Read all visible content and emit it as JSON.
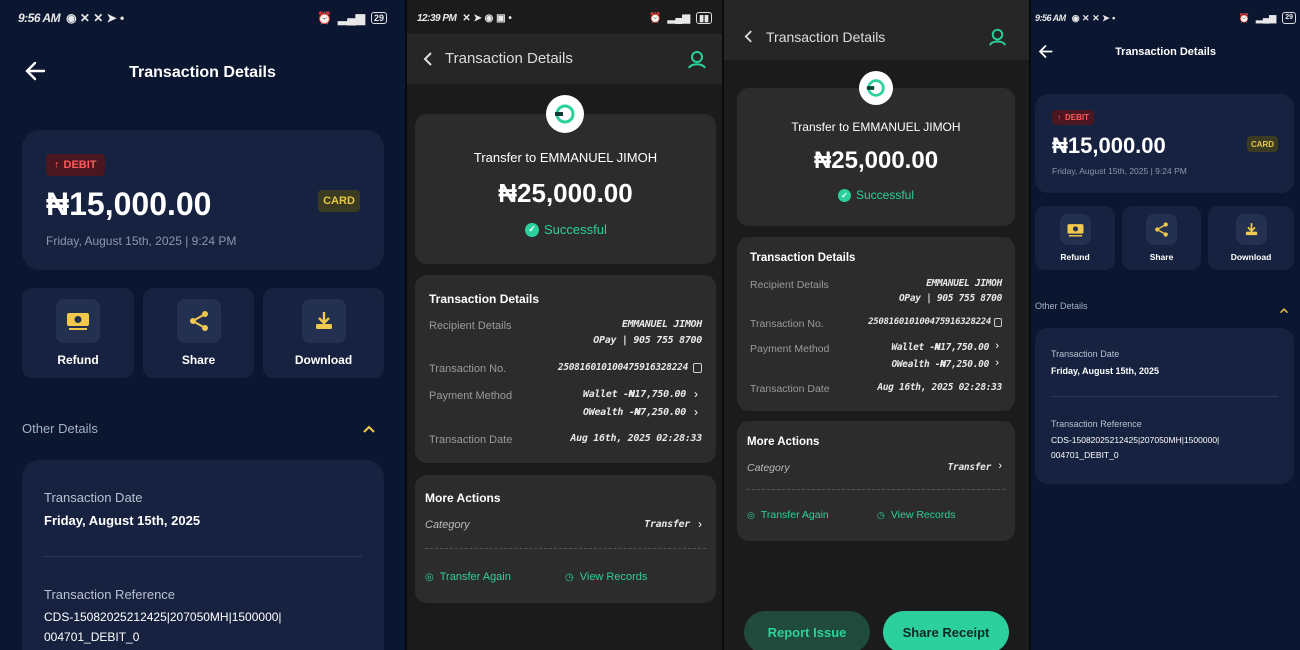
{
  "screen1": {
    "status": {
      "time": "9:56 AM",
      "battery": "29"
    },
    "title": "Transaction Details",
    "debit_label": "DEBIT",
    "amount": "₦15,000.00",
    "card_label": "CARD",
    "datetime": "Friday, August 15th, 2025 | 9:24 PM",
    "actions": [
      "Refund",
      "Share",
      "Download"
    ],
    "other_details": "Other Details",
    "date_label": "Transaction Date",
    "date_value": "Friday, August 15th, 2025",
    "ref_label": "Transaction Reference",
    "ref_line1": "CDS-15082025212425|207050MH|1500000|",
    "ref_line2": "004701_DEBIT_0"
  },
  "screen2": {
    "status": {
      "time": "12:39 PM"
    },
    "title": "Transaction Details",
    "transfer_to": "Transfer to EMMANUEL JIMOH",
    "amount": "₦25,000.00",
    "status_text": "Successful",
    "section": "Transaction Details",
    "recipient_label": "Recipient Details",
    "recipient_name": "EMMANUEL JIMOH",
    "recipient_bank": "OPay | 905 755 8700",
    "txn_no_label": "Transaction No.",
    "txn_no": "250816010100475916328224",
    "payment_label": "Payment Method",
    "pay1": "Wallet -₦17,750.00",
    "pay2": "OWealth -₦7,250.00",
    "date_label": "Transaction Date",
    "date_value": "Aug 16th, 2025 02:28:33",
    "more_actions": "More Actions",
    "category_label": "Category",
    "category_value": "Transfer",
    "transfer_again": "Transfer Again",
    "view_records": "View Records"
  },
  "screen3": {
    "title": "Transaction Details",
    "transfer_to": "Transfer to EMMANUEL JIMOH",
    "amount": "₦25,000.00",
    "status_text": "Successful",
    "section": "Transaction Details",
    "recipient_label": "Recipient Details",
    "recipient_name": "EMMANUEL JIMOH",
    "recipient_bank": "OPay | 905 755 8700",
    "txn_no_label": "Transaction No.",
    "txn_no": "250816010100475916328224",
    "payment_label": "Payment Method",
    "pay1": "Wallet -₦17,750.00",
    "pay2": "OWealth -₦7,250.00",
    "date_label": "Transaction Date",
    "date_value": "Aug 16th, 2025 02:28:33",
    "more_actions": "More Actions",
    "category_label": "Category",
    "category_value": "Transfer",
    "transfer_again": "Transfer Again",
    "view_records": "View Records",
    "report_issue": "Report Issue",
    "share_receipt": "Share Receipt"
  },
  "screen4": {
    "status": {
      "time": "9:56 AM",
      "battery": "29"
    },
    "title": "Transaction Details",
    "debit_label": "DEBIT",
    "amount": "₦15,000.00",
    "card_label": "CARD",
    "datetime": "Friday, August 15th, 2025 | 9:24 PM",
    "actions": [
      "Refund",
      "Share",
      "Download"
    ],
    "other_details": "Other Details",
    "date_label": "Transaction Date",
    "date_value": "Friday, August 15th, 2025",
    "ref_label": "Transaction Reference",
    "ref_line1": "CDS-15082025212425|207050MH|1500000|",
    "ref_line2": "004701_DEBIT_0"
  },
  "colors": {
    "navy_bg": "#0b1630",
    "navy_card": "#16223f",
    "gray_bg": "#1b1b1b",
    "gray_card": "#2c2c2c",
    "accent_green": "#2bd09c",
    "debit_red": "#ff5b5b",
    "card_gold": "#e8c64a"
  }
}
